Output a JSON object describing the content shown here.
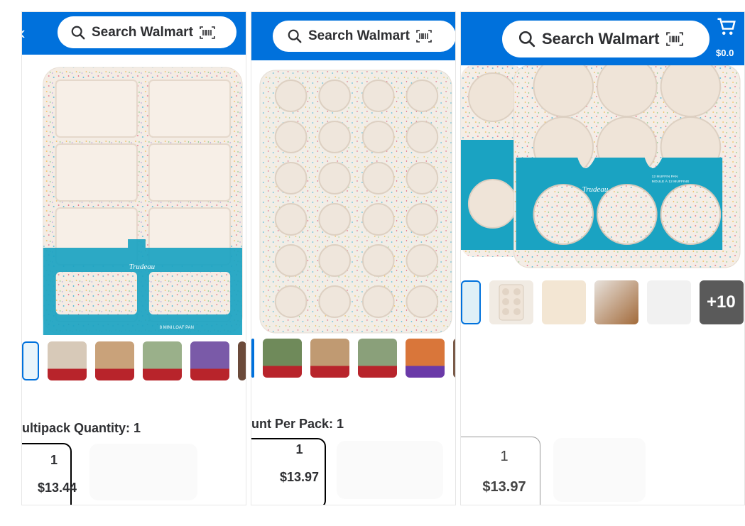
{
  "search": {
    "placeholder": "Search Walmart"
  },
  "panels": [
    {
      "variant_label": "ultipack Quantity: 1",
      "option": {
        "qty": "1",
        "price": "$13.44"
      },
      "product_caption": "8 MINI LOAF PAN",
      "brand": "Trudeau"
    },
    {
      "variant_label": "unt Per Pack: 1",
      "option": {
        "qty": "1",
        "price": "$13.97"
      }
    },
    {
      "cart_total": "$0.0",
      "more_images": "+10",
      "option": {
        "qty": "1",
        "price": "$13.97"
      },
      "product_caption": "12 MUFFIN PAN",
      "product_caption_fr": "MOULE À 12 MUFFINS",
      "brand": "Trudeau"
    }
  ],
  "colors": {
    "walmart_blue": "#0071dc",
    "teal_sleeve": "#1aa3c2",
    "speckle_bg": "#f3ece6"
  }
}
